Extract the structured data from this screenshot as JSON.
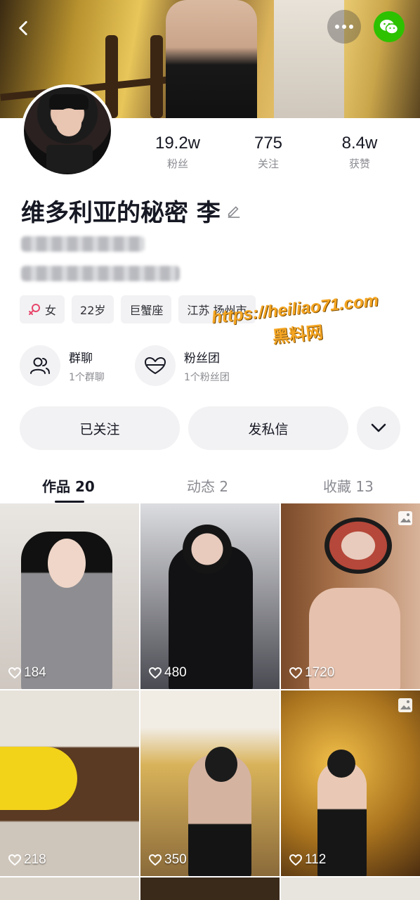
{
  "header": {
    "back_icon": "chevron-left-icon",
    "more_icon": "ellipsis-icon",
    "share_icon": "wechat-icon"
  },
  "profile": {
    "name": "维多利亚的秘密 李",
    "stats": [
      {
        "value": "19.2w",
        "label": "粉丝"
      },
      {
        "value": "775",
        "label": "关注"
      },
      {
        "value": "8.4w",
        "label": "获赞"
      }
    ],
    "tags": [
      {
        "icon": "female-icon",
        "label": "女"
      },
      {
        "label": "22岁"
      },
      {
        "label": "巨蟹座"
      },
      {
        "label": "江苏 扬州市"
      }
    ]
  },
  "watermark": {
    "url": "https://heiliao71.com",
    "text": "黑料网"
  },
  "groups": [
    {
      "icon": "group-chat-icon",
      "title": "群聊",
      "subtitle": "1个群聊"
    },
    {
      "icon": "fan-club-icon",
      "title": "粉丝团",
      "subtitle": "1个粉丝团"
    }
  ],
  "actions": {
    "followed_label": "已关注",
    "message_label": "发私信",
    "expand_icon": "chevron-down-icon"
  },
  "tabs": [
    {
      "label": "作品 20",
      "active": true
    },
    {
      "label": "动态 2",
      "active": false
    },
    {
      "label": "收藏 13",
      "active": false
    }
  ],
  "posts": [
    {
      "likes": "184",
      "gallery": false
    },
    {
      "likes": "480",
      "gallery": false
    },
    {
      "likes": "1720",
      "gallery": true
    },
    {
      "likes": "218",
      "gallery": false
    },
    {
      "likes": "350",
      "gallery": false
    },
    {
      "likes": "112",
      "gallery": true
    }
  ],
  "colors": {
    "wechat_green": "#2dc100",
    "watermark_orange": "#f5a623",
    "text_primary": "#161823",
    "text_secondary": "#8a8b91",
    "chip_bg": "#f2f2f4"
  }
}
